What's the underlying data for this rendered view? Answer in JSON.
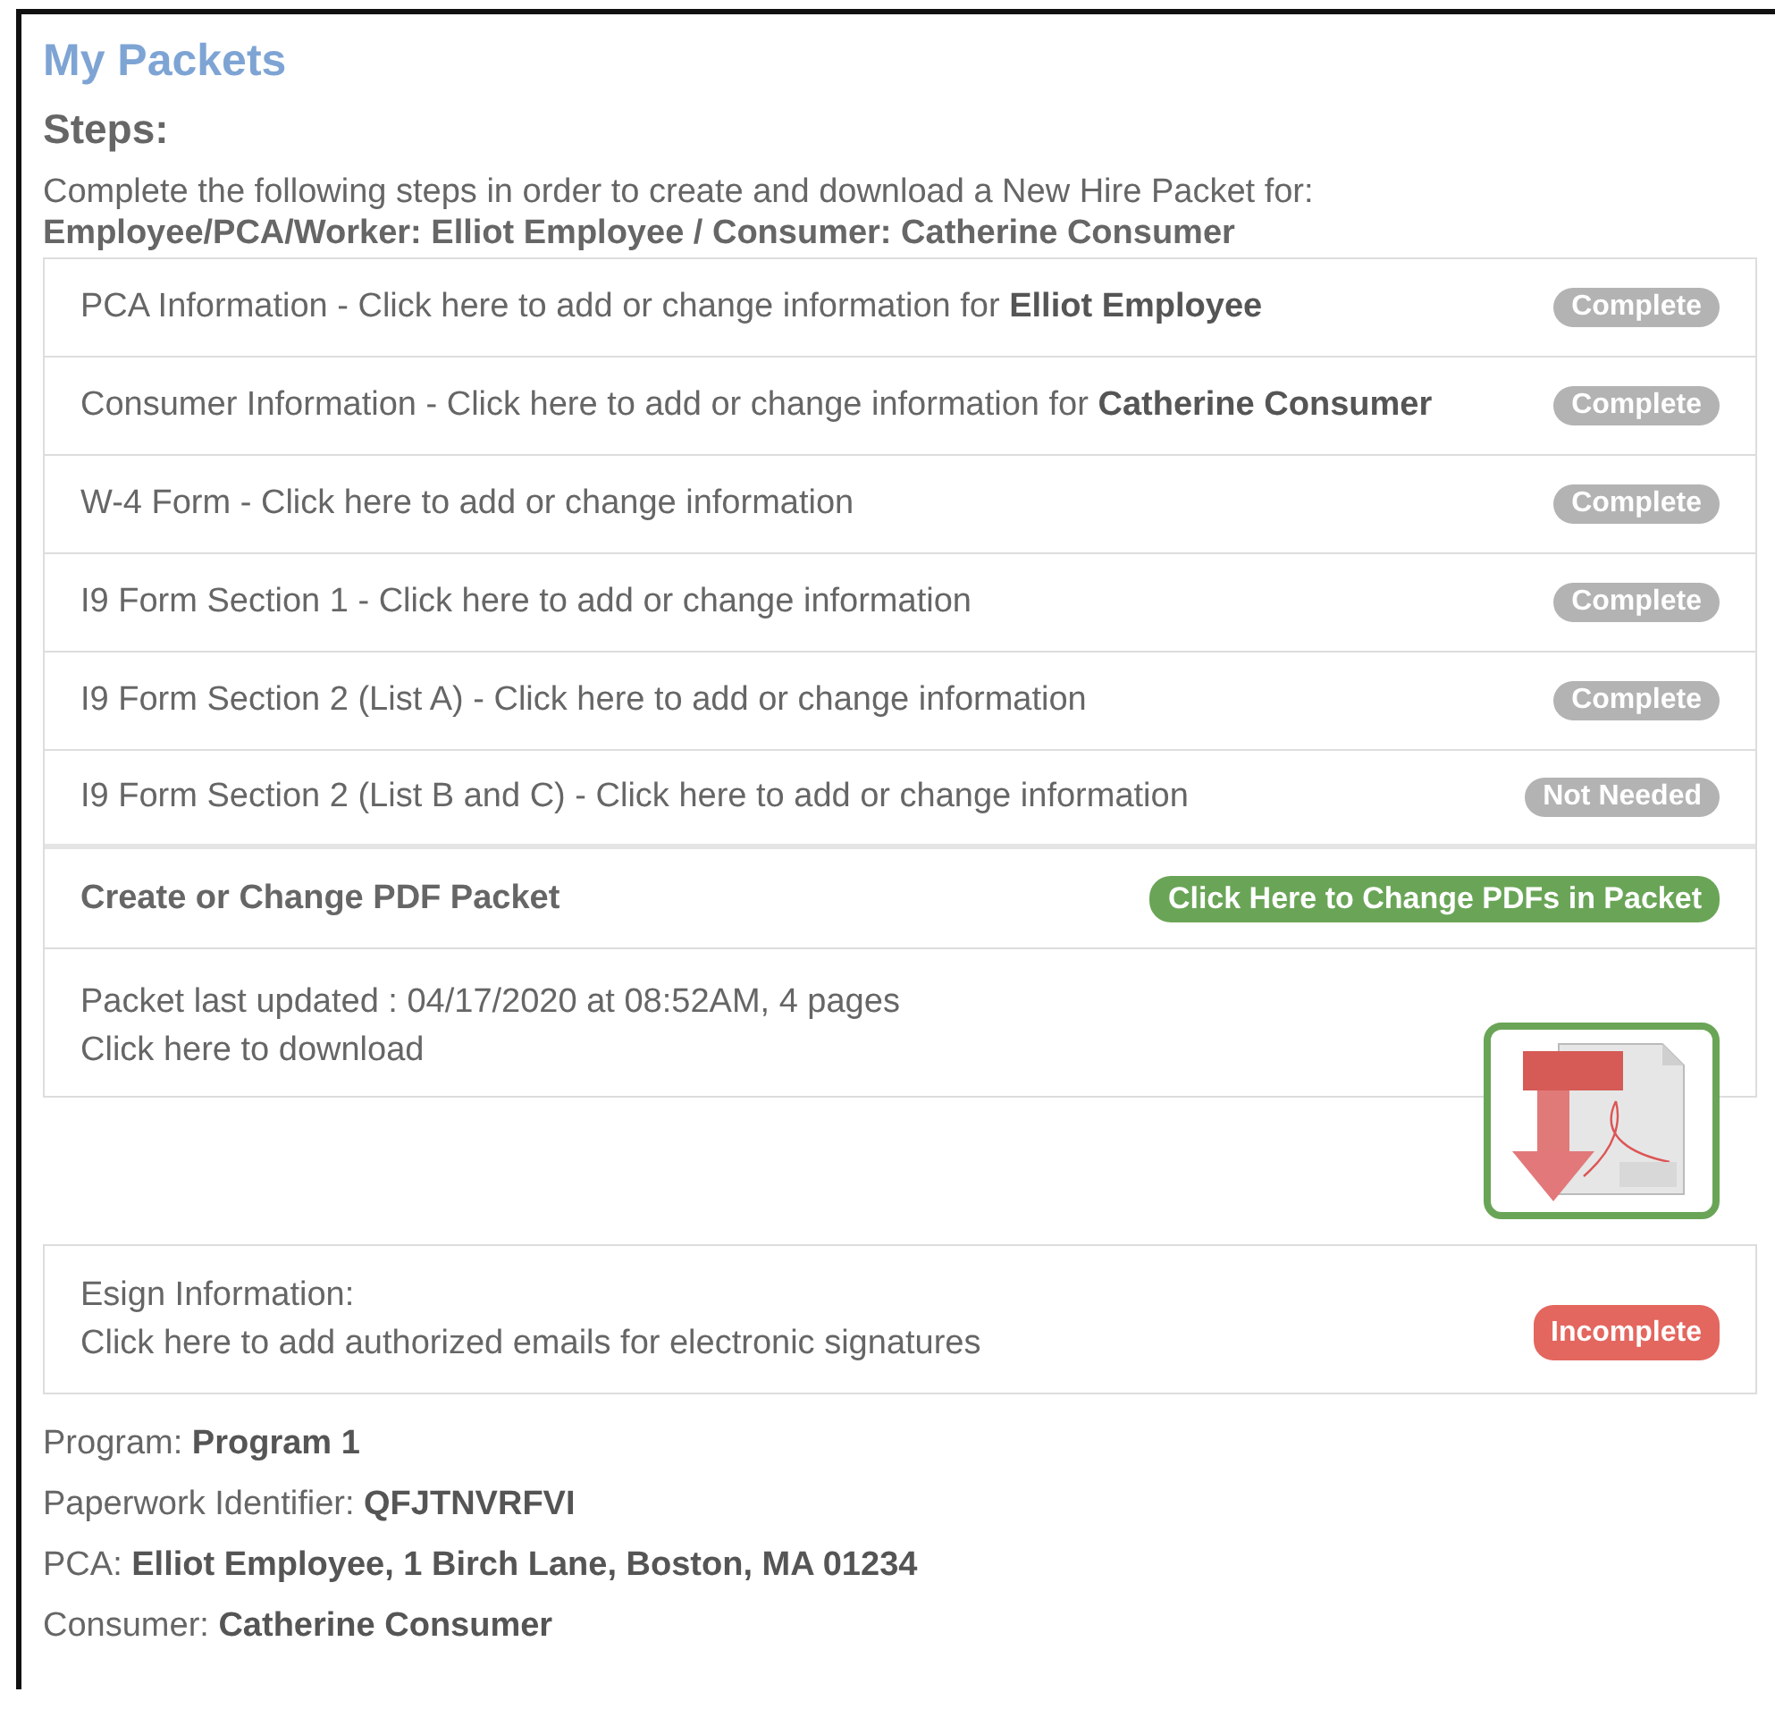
{
  "title": "My Packets",
  "steps_heading": "Steps:",
  "intro": "Complete the following steps in order to create and download a New Hire Packet for:",
  "subject": "Employee/PCA/Worker: Elliot Employee / Consumer: Catherine Consumer",
  "steps": [
    {
      "text": "PCA Information - Click here to add or change information for **Elliot Employee**",
      "status": {
        "label": "Complete",
        "color": "#b3b3b3"
      }
    },
    {
      "text": "Consumer Information - Click here to add or change information for **Catherine Consumer**",
      "status": {
        "label": "Complete",
        "color": "#b3b3b3"
      }
    },
    {
      "text": "W-4 Form - Click here to add or change information",
      "status": {
        "label": "Complete",
        "color": "#b3b3b3"
      }
    },
    {
      "text": "I9 Form Section 1 - Click here to add or change information",
      "status": {
        "label": "Complete",
        "color": "#b3b3b3"
      }
    },
    {
      "text": "I9 Form Section 2 (List A) - Click here to add or change information",
      "status": {
        "label": "Complete",
        "color": "#b3b3b3"
      }
    },
    {
      "text": "I9 Form Section 2 (List B and C) - Click here to add or change information",
      "status": {
        "label": "Not Needed",
        "color": "#b3b3b3"
      }
    }
  ],
  "create_packet": {
    "label": "Create or Change PDF Packet",
    "button": "Click Here to Change PDFs in Packet"
  },
  "packet": {
    "updated": "Packet last updated : 04/17/2020 at 08:52AM, 4 pages",
    "download": "Click here to download"
  },
  "esign": {
    "title": "Esign Information:",
    "text": "Click here to add authorized emails for electronic signatures",
    "status": {
      "label": "Incomplete",
      "color": "#e3675f"
    }
  },
  "details": [
    {
      "text": "Program: **Program 1**"
    },
    {
      "text": "Paperwork Identifier: **QFJTNVRFVI**"
    },
    {
      "text": "PCA: **Elliot Employee, 1 Birch Lane, Boston, MA 01234**"
    },
    {
      "text": "Consumer: **Catherine Consumer**"
    }
  ]
}
